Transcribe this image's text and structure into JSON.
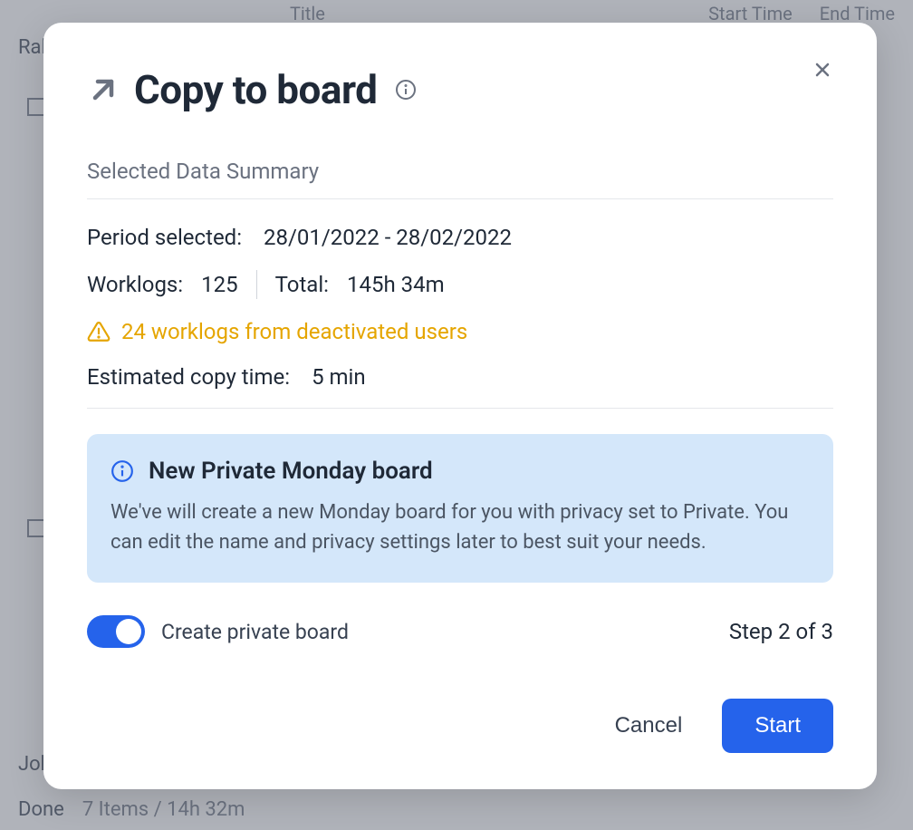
{
  "background": {
    "columns": {
      "title": "Title",
      "start_time": "Start Time",
      "end_time": "End Time"
    },
    "rows": {
      "row1": "Ral",
      "row2": "Joh"
    },
    "footer": {
      "done": "Done",
      "summary": "7 Items / 14h 32m"
    }
  },
  "modal": {
    "title": "Copy to board",
    "section_title": "Selected Data Summary",
    "period": {
      "label": "Period selected:",
      "value": "28/01/2022 - 28/02/2022"
    },
    "worklogs": {
      "label": "Worklogs:",
      "value": "125"
    },
    "total": {
      "label": "Total:",
      "value": "145h 34m"
    },
    "warning": "24 worklogs from deactivated users",
    "estimate": {
      "label": "Estimated copy time:",
      "value": "5 min"
    },
    "info_box": {
      "title": "New Private Monday board",
      "text": "We've will create a new Monday board for you with privacy set to Private. You can edit the name and privacy settings later to best suit your needs."
    },
    "toggle_label": "Create private board",
    "step_label": "Step 2 of 3",
    "cancel_label": "Cancel",
    "start_label": "Start"
  }
}
